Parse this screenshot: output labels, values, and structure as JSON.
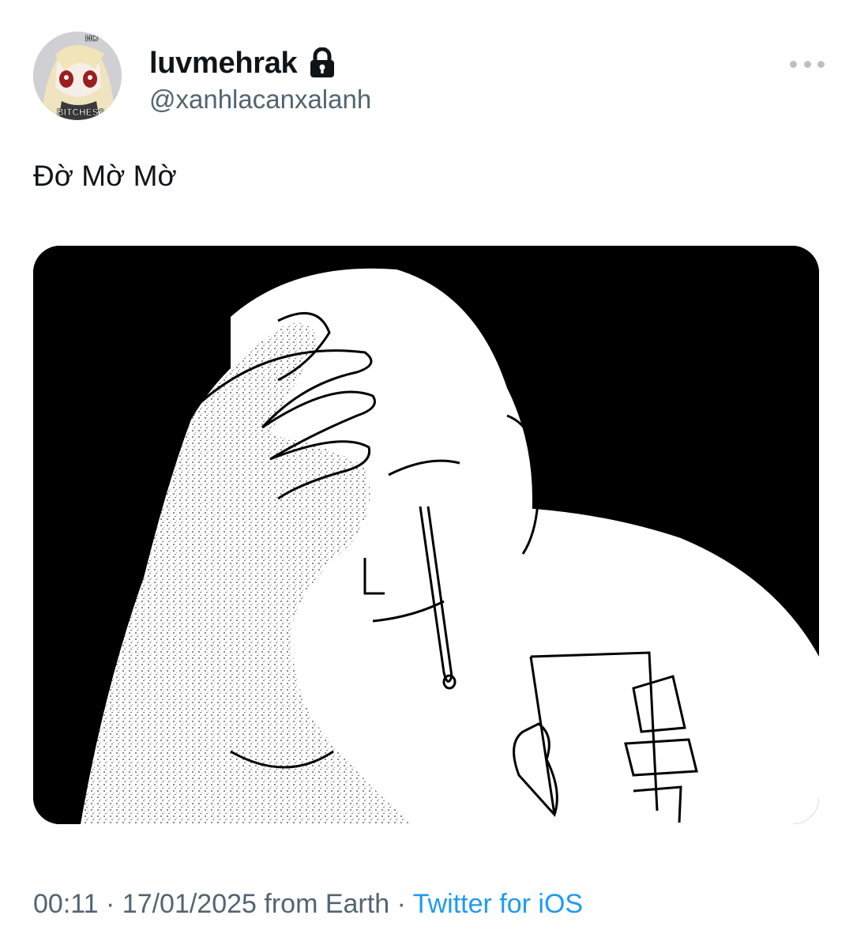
{
  "user": {
    "display_name": "luvmehrak",
    "handle": "@xanhlacanxalanh",
    "locked_icon": "lock-icon",
    "avatar_caption_top": "NO",
    "avatar_caption_bottom": "BITCHES?"
  },
  "tweet": {
    "text": "Đờ Mờ Mờ",
    "more_icon": "more-horizontal-icon"
  },
  "meta": {
    "time": "00:11",
    "separator_1": " · ",
    "date": "17/01/2025",
    "location": " from Earth",
    "separator_2": " · ",
    "source": "Twitter for iOS"
  },
  "colors": {
    "text_primary": "#0f1419",
    "text_secondary": "#536471",
    "link": "#1d9bf0",
    "media_background": "#000000"
  }
}
